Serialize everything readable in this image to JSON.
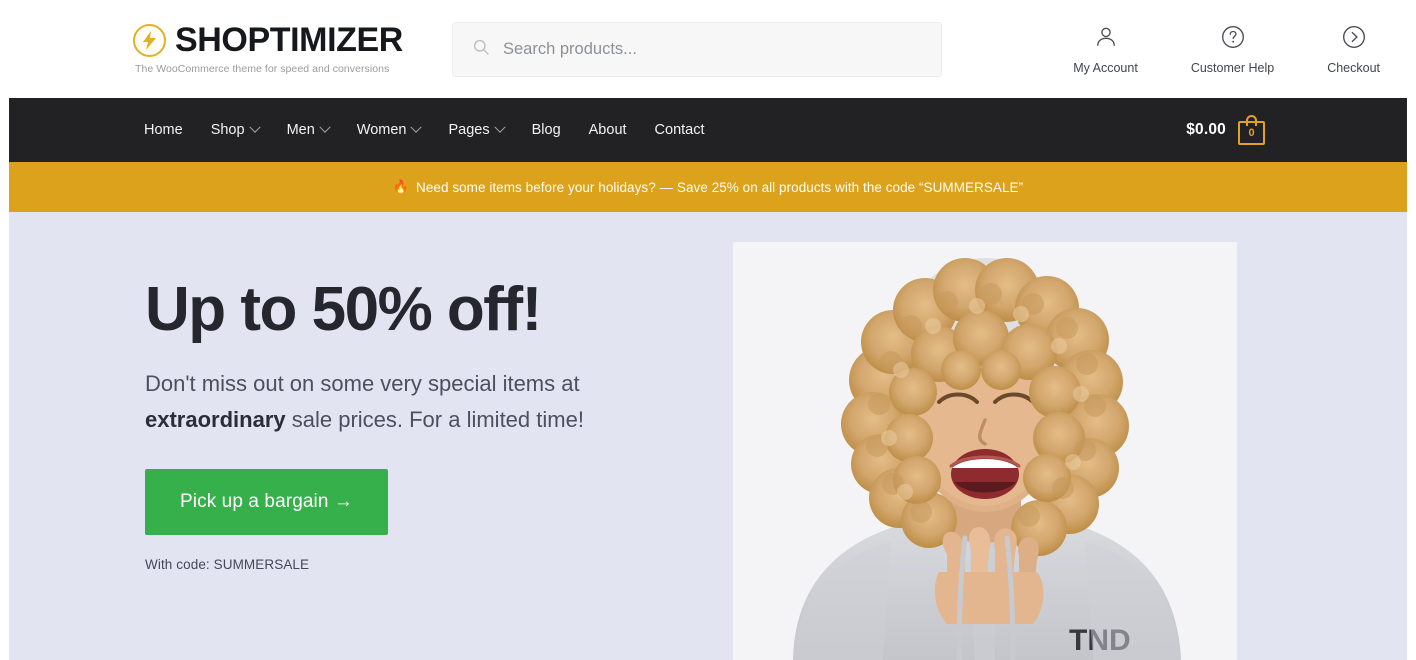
{
  "header": {
    "logo_icon": "lightning-bolt-circle-icon",
    "brand_name": "SHOPTIMIZER",
    "tagline": "The WooCommerce theme for speed and conversions",
    "search": {
      "icon": "search-icon",
      "placeholder": "Search products...",
      "value": ""
    },
    "actions": [
      {
        "icon": "user-icon",
        "label": "My Account"
      },
      {
        "icon": "question-circle-icon",
        "label": "Customer Help"
      },
      {
        "icon": "chevron-right-circle-icon",
        "label": "Checkout"
      }
    ]
  },
  "nav": {
    "items": [
      {
        "label": "Home",
        "has_dropdown": false
      },
      {
        "label": "Shop",
        "has_dropdown": true
      },
      {
        "label": "Men",
        "has_dropdown": true
      },
      {
        "label": "Women",
        "has_dropdown": true
      },
      {
        "label": "Pages",
        "has_dropdown": true
      },
      {
        "label": "Blog",
        "has_dropdown": false
      },
      {
        "label": "About",
        "has_dropdown": false
      },
      {
        "label": "Contact",
        "has_dropdown": false
      }
    ],
    "cart": {
      "total": "$0.00",
      "count": "0",
      "icon": "shopping-bag-icon"
    }
  },
  "promo": {
    "icon": "fire-icon",
    "icon_glyph": "🔥",
    "text": "Need some items before your holidays? — Save 25% on all products with the code “SUMMERSALE”"
  },
  "hero": {
    "title": "Up to 50% off!",
    "subtitle_line1": "Don't miss out on some very special items at",
    "subtitle_bold": "extraordinary",
    "subtitle_line2": " sale prices. For a limited time!",
    "cta_label": "Pick up a bargain →",
    "code_note": "With code: SUMMERSALE",
    "image_alt": "Laughing person with curly blonde hair wearing a grey hoodie"
  },
  "colors": {
    "nav_background": "#222224",
    "promo_background": "#dca21c",
    "hero_background": "#e3e4f1",
    "cta_green": "#36b04a",
    "brand_gold": "#e0b127",
    "page_background": "#ffffff"
  }
}
